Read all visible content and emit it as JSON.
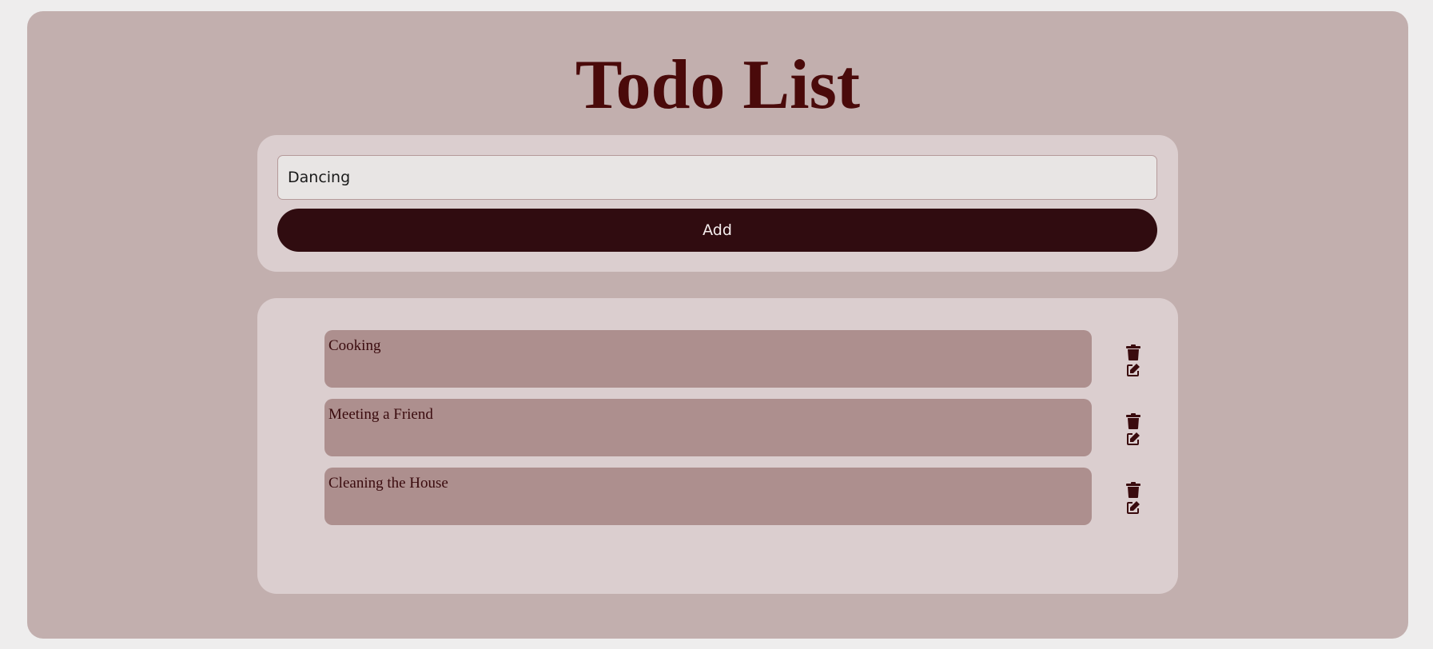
{
  "app": {
    "title": "Todo List"
  },
  "form": {
    "input_value": "Dancing",
    "add_label": "Add"
  },
  "todos": [
    {
      "text": "Cooking"
    },
    {
      "text": "Meeting a Friend"
    },
    {
      "text": "Cleaning the House"
    }
  ],
  "icons": {
    "delete": "trash-icon",
    "edit": "edit-icon"
  },
  "colors": {
    "background": "#c2afae",
    "card": "#dbcecf",
    "accent": "#300c10",
    "title": "#4a0a0a",
    "item": "#ad8f8e"
  }
}
